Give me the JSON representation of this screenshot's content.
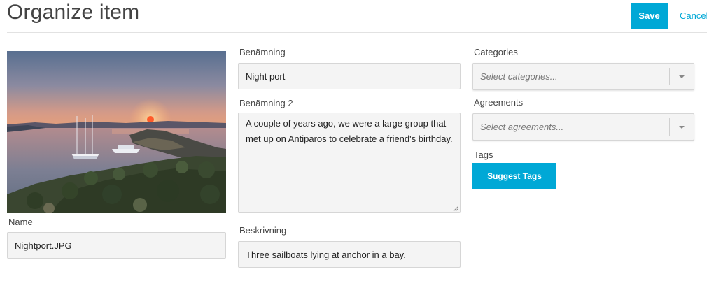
{
  "header": {
    "title": "Organize item",
    "save_label": "Save",
    "cancel_label": "Cancel"
  },
  "name": {
    "label": "Name",
    "value": "Nightport.JPG"
  },
  "benamning": {
    "label": "Benämning",
    "value": "Night port"
  },
  "benamning2": {
    "label": "Benämning 2",
    "value": "A couple of years ago, we were a large group that met up on Antiparos to celebrate a friend's birthday."
  },
  "beskrivning": {
    "label": "Beskrivning",
    "value": "Three sailboats lying at anchor in a bay."
  },
  "categories": {
    "label": "Categories",
    "placeholder": "Select categories..."
  },
  "agreements": {
    "label": "Agreements",
    "placeholder": "Select agreements..."
  },
  "tags": {
    "label": "Tags",
    "suggest_label": "Suggest Tags"
  },
  "colors": {
    "accent": "#00a8d6"
  }
}
